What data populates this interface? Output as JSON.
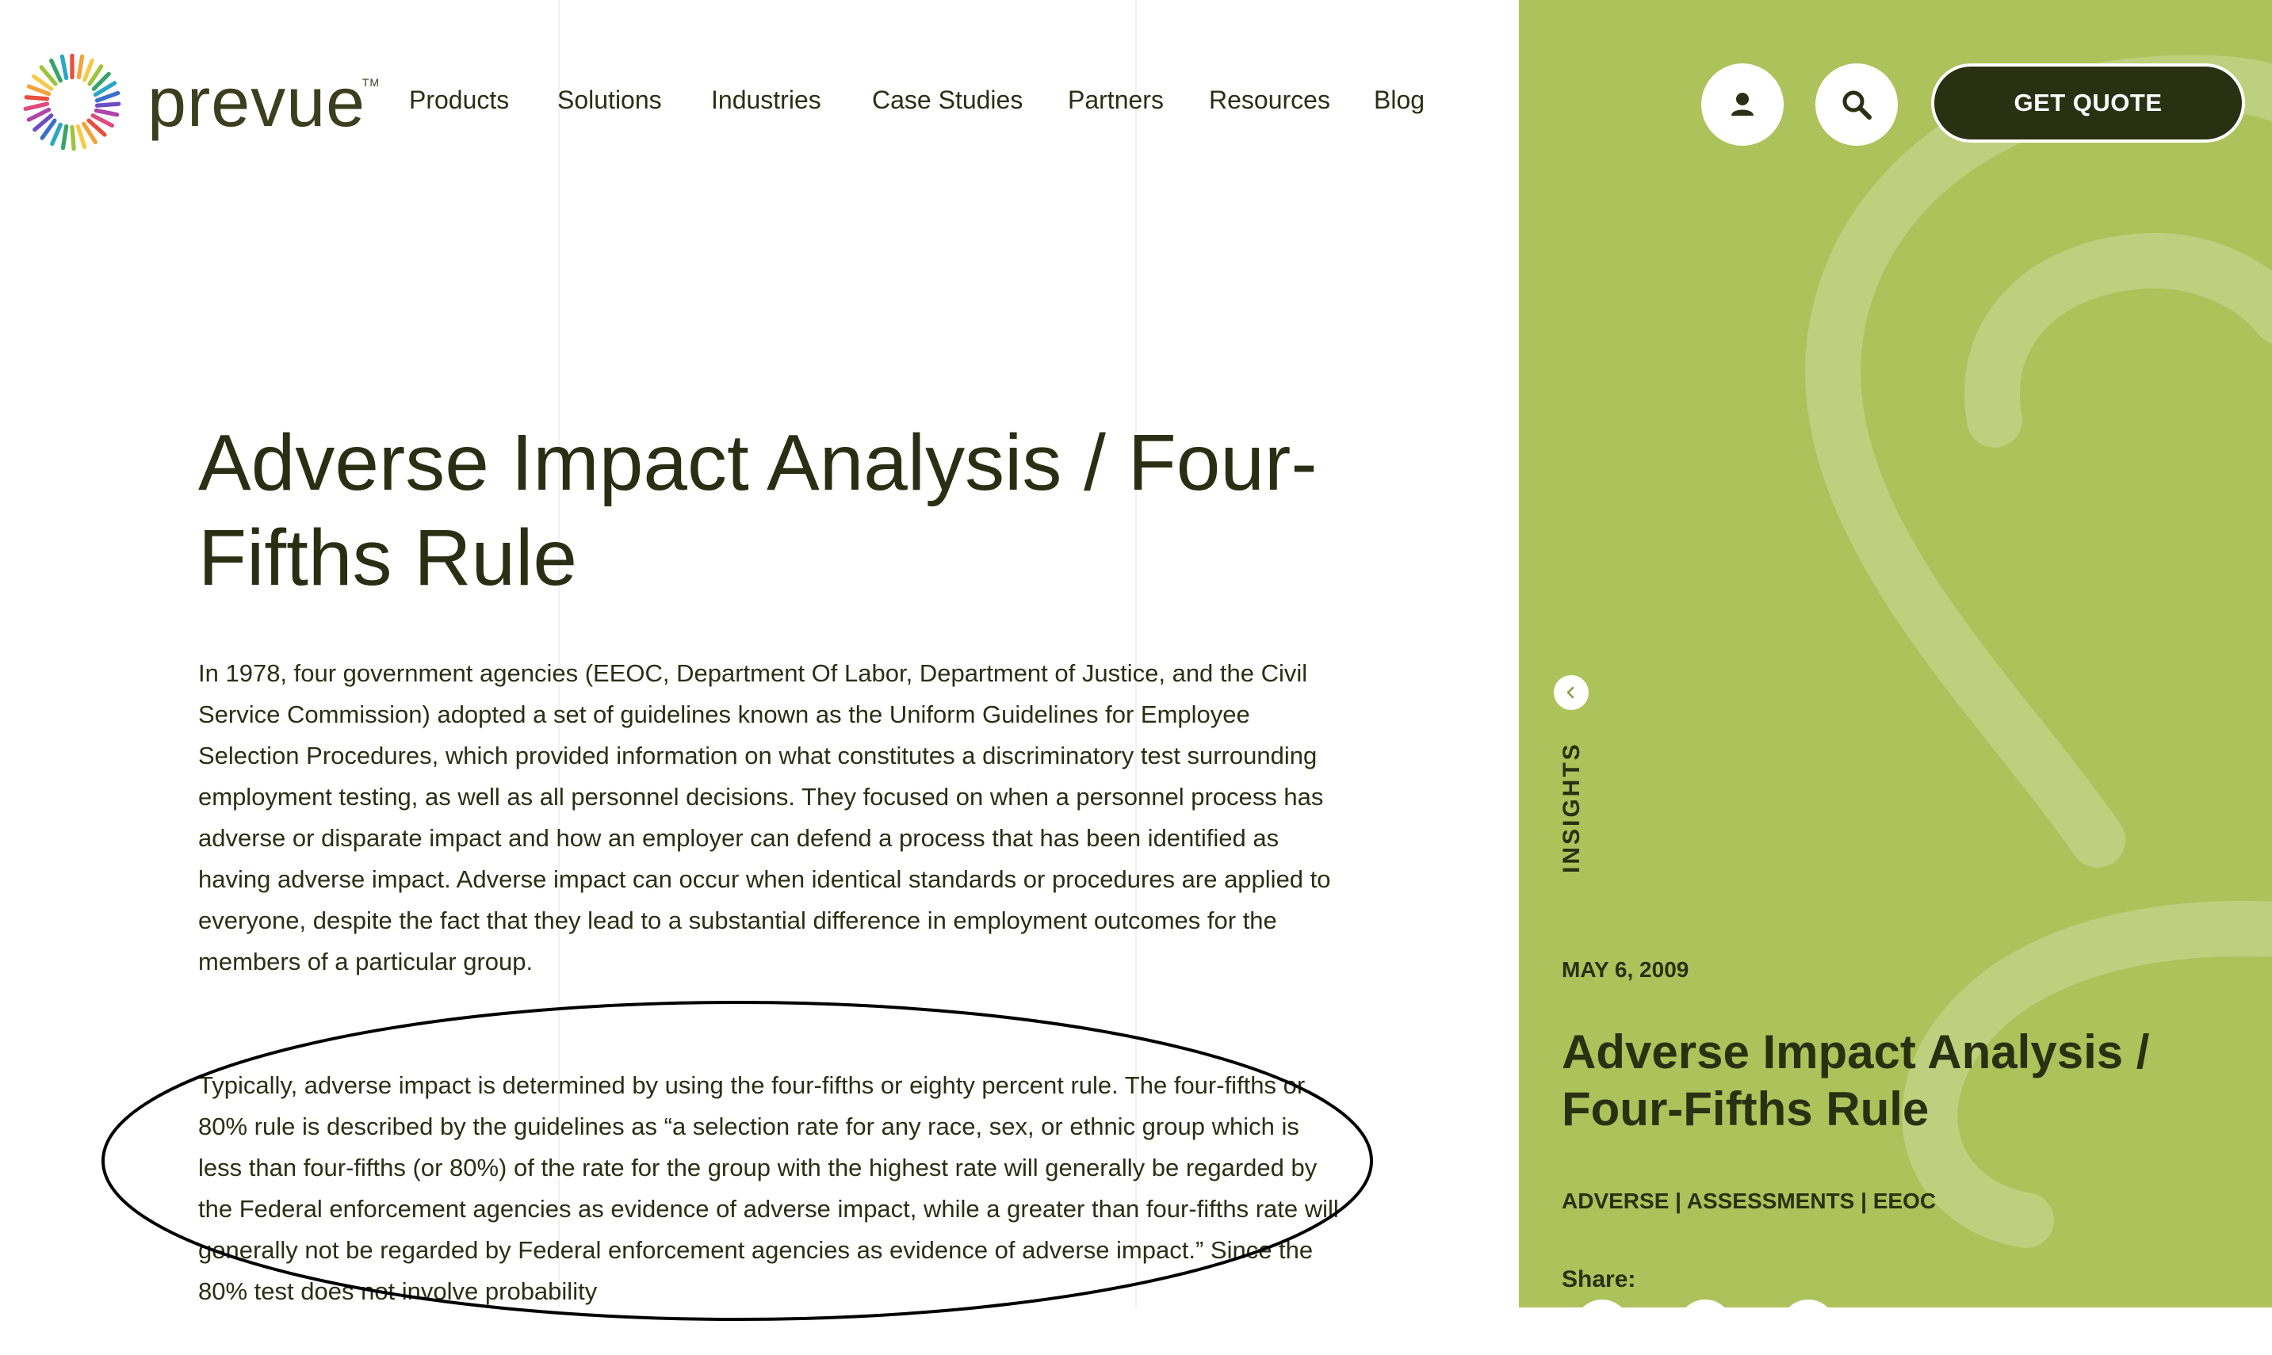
{
  "brand": {
    "name": "prevue",
    "trademark": "TM"
  },
  "nav": {
    "items": [
      {
        "label": "Products"
      },
      {
        "label": "Solutions"
      },
      {
        "label": "Industries"
      },
      {
        "label": "Case Studies"
      },
      {
        "label": "Partners"
      },
      {
        "label": "Resources"
      },
      {
        "label": "Blog"
      }
    ]
  },
  "header": {
    "account_icon": "user-icon",
    "search_icon": "search-icon",
    "quote_label": "GET QUOTE"
  },
  "article": {
    "title": "Adverse Impact Analysis / Four-Fifths Rule",
    "paragraph1": "In 1978, four government agencies (EEOC, Department Of Labor, Department of Justice, and the Civil Service Commission) adopted a set of guidelines known as the Uniform Guidelines for Employee Selection Procedures, which provided information on what constitutes a discriminatory test surrounding employment testing, as well as all personnel decisions.  They focused on when a personnel process has adverse or disparate impact and how an employer can defend a process that has been identified as having adverse impact.  Adverse impact can occur when identical standards or procedures are applied to everyone, despite the fact that they lead to a substantial difference in employment outcomes for the members of a particular group.",
    "paragraph2": "Typically, adverse impact is determined by using the four-fifths or eighty percent rule.  The four-fifths or 80% rule is described by the guidelines as “a selection rate for any race, sex, or ethnic group which is less than four-fifths (or 80%) of the rate for the group with the highest rate will generally be regarded by the Federal enforcement agencies as evidence of adverse impact, while a greater than four-fifths rate will generally not be regarded by Federal enforcement agencies as evidence of adverse impact.”  Since the 80% test does not involve probability"
  },
  "sidebar": {
    "section_label": "INSIGHTS",
    "date": "MAY 6, 2009",
    "title": "Adverse Impact Analysis / Four-Fifths Rule",
    "tags": "ADVERSE | ASSESSMENTS | EEOC",
    "share_label": "Share:",
    "back_icon": "chevron-left-icon"
  },
  "colors": {
    "panel_green": "#adc25a",
    "dark_olive": "#2a3012",
    "text": "#2a2f14"
  }
}
